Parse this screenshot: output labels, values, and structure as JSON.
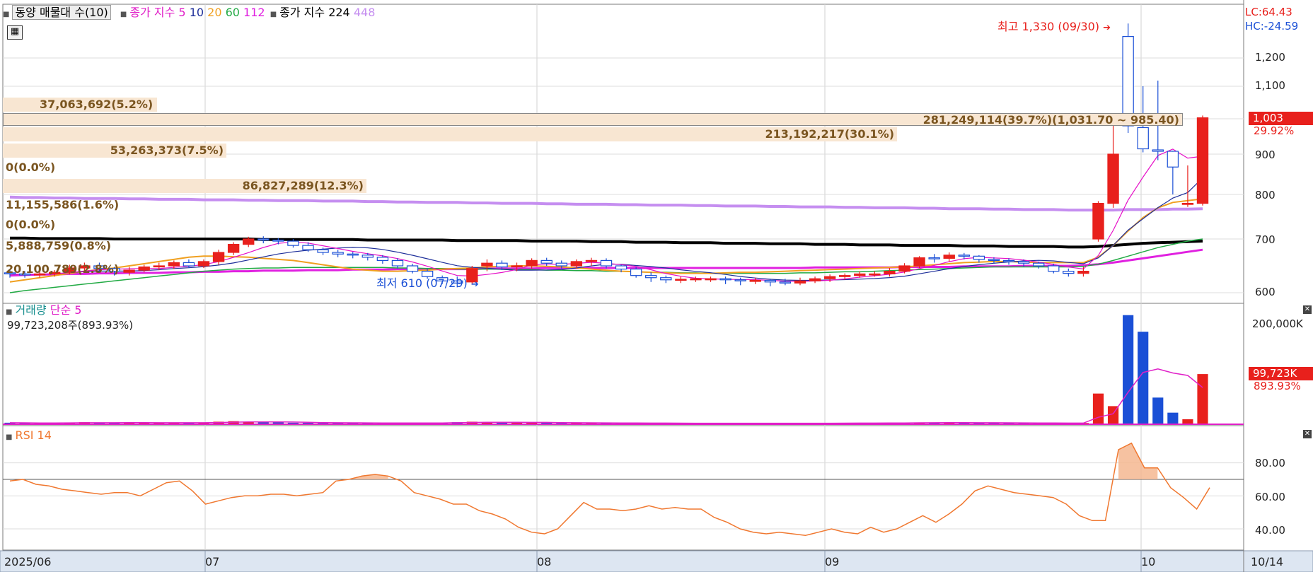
{
  "header": {
    "indicator_label": "동양 매물대 수(10)",
    "ma_label": "종가 지수",
    "ma_periods": [
      "5",
      "10",
      "20",
      "60",
      "112"
    ],
    "ma2_label": "종가 지수 224",
    "ma2_extra": "448"
  },
  "colors": {
    "up": "#e8201c",
    "down": "#1a4fd6",
    "ma5": "#e60fc8",
    "ma10": "#1e2f9a",
    "ma20": "#f0a020",
    "ma60": "#22aa44",
    "ma112": "#e020e0",
    "ma224": "#000000",
    "ma448": "#c58ef0",
    "rsi": "#f07830",
    "volume_ma": "#e020c8"
  },
  "price_panel": {
    "lc": "LC:64.43",
    "hc": "HC:-24.59",
    "last_price_tag": "1,003",
    "last_change_tag": "29.92%",
    "high_marker": "최고 1,330 (09/30)",
    "low_marker": "최저 610 (07/29)",
    "y_ticks": [
      "1,200",
      "1,100",
      "1,000",
      "900",
      "800",
      "700",
      "600"
    ],
    "volume_profile": [
      "37,063,692(5.2%)",
      "281,249,114(39.7%)(1,031.70 ~ 985.40)",
      "213,192,217(30.1%)",
      "53,263,373(7.5%)",
      "0(0.0%)",
      "86,827,289(12.3%)",
      "11,155,586(1.6%)",
      "0(0.0%)",
      "5,888,759(0.8%)",
      "20,100,789(2.8%)"
    ]
  },
  "volume_panel": {
    "title": "거래량",
    "ma_label": "단순 5",
    "current": "99,723,208주(893.93%)",
    "y_tick": "200,000K",
    "last_tag": "99,723K",
    "last_pct": "893.93%"
  },
  "rsi_panel": {
    "title": "RSI 14",
    "y_ticks": [
      "80.00",
      "60.00",
      "40.00"
    ]
  },
  "x_axis": {
    "labels": [
      "2025/06",
      "07",
      "08",
      "09",
      "10"
    ],
    "right_label": "10/14"
  },
  "chart_data": [
    {
      "type": "candlestick",
      "ylim": [
        580,
        1360
      ],
      "x": [
        "06/16",
        "06/17",
        "06/18",
        "06/19",
        "06/20",
        "06/23",
        "06/24",
        "06/25",
        "06/26",
        "06/27",
        "06/30",
        "07/01",
        "07/02",
        "07/03",
        "07/04",
        "07/07",
        "07/08",
        "07/09",
        "07/10",
        "07/11",
        "07/14",
        "07/15",
        "07/16",
        "07/17",
        "07/18",
        "07/21",
        "07/22",
        "07/23",
        "07/24",
        "07/25",
        "07/28",
        "07/29",
        "07/30",
        "07/31",
        "08/01",
        "08/04",
        "08/05",
        "08/06",
        "08/07",
        "08/08",
        "08/11",
        "08/12",
        "08/13",
        "08/14",
        "08/18",
        "08/19",
        "08/20",
        "08/21",
        "08/22",
        "08/25",
        "08/26",
        "08/27",
        "08/28",
        "08/29",
        "09/01",
        "09/02",
        "09/03",
        "09/04",
        "09/05",
        "09/08",
        "09/09",
        "09/10",
        "09/11",
        "09/12",
        "09/15",
        "09/16",
        "09/17",
        "09/18",
        "09/19",
        "09/22",
        "09/23",
        "09/24",
        "09/25",
        "09/26",
        "09/29",
        "09/30",
        "10/01",
        "10/02",
        "10/10",
        "10/13",
        "10/14"
      ],
      "open": [
        637,
        635,
        633,
        635,
        638,
        646,
        650,
        645,
        638,
        642,
        648,
        650,
        656,
        650,
        658,
        675,
        690,
        700,
        698,
        696,
        688,
        680,
        675,
        672,
        670,
        666,
        660,
        650,
        640,
        628,
        622,
        620,
        650,
        655,
        648,
        650,
        660,
        655,
        650,
        658,
        660,
        650,
        644,
        632,
        628,
        624,
        625,
        626,
        626,
        624,
        622,
        623,
        620,
        618,
        622,
        626,
        630,
        632,
        635,
        635,
        640,
        650,
        665,
        664,
        670,
        668,
        662,
        660,
        658,
        655,
        650,
        640,
        636,
        700,
        780,
        1280,
        975,
        912,
        908,
        778,
        780
      ],
      "close": [
        635,
        633,
        635,
        638,
        646,
        650,
        645,
        640,
        642,
        648,
        650,
        656,
        650,
        658,
        675,
        690,
        700,
        698,
        696,
        688,
        680,
        675,
        672,
        670,
        666,
        660,
        650,
        640,
        630,
        622,
        618,
        645,
        655,
        648,
        650,
        660,
        655,
        650,
        658,
        660,
        650,
        644,
        632,
        628,
        624,
        625,
        626,
        626,
        624,
        622,
        623,
        620,
        618,
        622,
        626,
        630,
        632,
        635,
        635,
        640,
        650,
        665,
        664,
        670,
        668,
        662,
        660,
        658,
        655,
        650,
        640,
        636,
        640,
        780,
        900,
        980,
        915,
        908,
        868,
        780,
        1003
      ],
      "high": [
        642,
        640,
        640,
        642,
        652,
        656,
        656,
        648,
        648,
        652,
        656,
        660,
        662,
        662,
        680,
        694,
        705,
        706,
        702,
        700,
        694,
        684,
        680,
        676,
        674,
        670,
        664,
        654,
        645,
        632,
        630,
        650,
        662,
        660,
        656,
        664,
        665,
        660,
        662,
        665,
        664,
        652,
        648,
        638,
        632,
        630,
        630,
        630,
        630,
        628,
        628,
        626,
        626,
        628,
        630,
        634,
        636,
        640,
        640,
        646,
        655,
        668,
        672,
        675,
        674,
        670,
        666,
        664,
        662,
        658,
        654,
        645,
        648,
        785,
        1010,
        1330,
        1100,
        1120,
        910,
        872,
        1010
      ],
      "low": [
        628,
        628,
        628,
        630,
        634,
        640,
        640,
        632,
        632,
        638,
        642,
        644,
        646,
        646,
        652,
        670,
        685,
        692,
        690,
        684,
        676,
        670,
        666,
        664,
        660,
        654,
        645,
        636,
        626,
        616,
        610,
        615,
        640,
        642,
        640,
        645,
        650,
        645,
        645,
        650,
        645,
        638,
        628,
        620,
        618,
        618,
        620,
        620,
        616,
        614,
        616,
        612,
        614,
        614,
        618,
        620,
        624,
        628,
        630,
        630,
        636,
        646,
        656,
        658,
        662,
        656,
        654,
        652,
        648,
        645,
        636,
        630,
        630,
        695,
        770,
        960,
        905,
        885,
        800,
        772,
        775
      ],
      "ma20": [
        620,
        624,
        628,
        632,
        636,
        640,
        643,
        646,
        650,
        654,
        658,
        662,
        666,
        668,
        668,
        667,
        666,
        664,
        662,
        660,
        656,
        652,
        648,
        644,
        642,
        640,
        640,
        641,
        642,
        644,
        645,
        646,
        648,
        649,
        650,
        650,
        649,
        648,
        646,
        644,
        642,
        640,
        639,
        638,
        637,
        636,
        636,
        636,
        637,
        638,
        638,
        639,
        640,
        641,
        642,
        643,
        644,
        645,
        646,
        647,
        648,
        650,
        652,
        654,
        656,
        657,
        658,
        658,
        657,
        656,
        656,
        656,
        656,
        666,
        688,
        718,
        748,
        770,
        782,
        786,
        790
      ],
      "ma60": [
        600,
        604,
        607,
        610,
        613,
        616,
        619,
        622,
        625,
        628,
        631,
        634,
        637,
        640,
        642,
        644,
        645,
        646,
        646,
        647,
        647,
        647,
        647,
        647,
        647,
        647,
        646,
        646,
        645,
        645,
        644,
        644,
        644,
        644,
        643,
        643,
        642,
        642,
        641,
        641,
        640,
        640,
        639,
        638,
        638,
        637,
        637,
        636,
        636,
        636,
        636,
        636,
        636,
        637,
        637,
        638,
        639,
        639,
        640,
        641,
        642,
        643,
        644,
        645,
        646,
        647,
        648,
        648,
        648,
        648,
        648,
        648,
        649,
        653,
        660,
        668,
        676,
        684,
        690,
        696,
        700
      ],
      "ma112": [
        632,
        633,
        634,
        634,
        635,
        635,
        636,
        636,
        637,
        637,
        637,
        638,
        638,
        639,
        639,
        640,
        640,
        641,
        641,
        641,
        642,
        642,
        642,
        643,
        643,
        643,
        644,
        644,
        644,
        644,
        644,
        644,
        645,
        645,
        645,
        645,
        646,
        646,
        646,
        646,
        646,
        646,
        646,
        646,
        646,
        646,
        646,
        646,
        646,
        646,
        646,
        646,
        646,
        646,
        647,
        647,
        647,
        647,
        647,
        647,
        648,
        648,
        648,
        648,
        649,
        649,
        649,
        649,
        650,
        650,
        650,
        650,
        651,
        653,
        656,
        660,
        664,
        668,
        672,
        676,
        680
      ],
      "ma224": [
        702,
        702,
        701,
        701,
        701,
        701,
        701,
        700,
        700,
        700,
        700,
        700,
        700,
        700,
        700,
        700,
        700,
        699,
        699,
        699,
        699,
        699,
        699,
        699,
        698,
        698,
        698,
        698,
        698,
        698,
        697,
        697,
        697,
        697,
        697,
        696,
        696,
        696,
        696,
        695,
        695,
        695,
        694,
        694,
        694,
        693,
        693,
        693,
        692,
        692,
        692,
        691,
        691,
        691,
        690,
        690,
        690,
        689,
        689,
        689,
        688,
        688,
        688,
        688,
        687,
        687,
        687,
        686,
        686,
        686,
        686,
        685,
        685,
        686,
        688,
        690,
        692,
        693,
        694,
        695,
        696
      ],
      "ma448": [
        794,
        793,
        793,
        792,
        792,
        791,
        791,
        791,
        790,
        790,
        789,
        789,
        789,
        788,
        788,
        788,
        787,
        787,
        786,
        786,
        786,
        785,
        785,
        785,
        784,
        784,
        783,
        783,
        782,
        782,
        782,
        781,
        781,
        780,
        780,
        780,
        779,
        779,
        778,
        778,
        778,
        777,
        777,
        776,
        776,
        776,
        775,
        775,
        774,
        774,
        774,
        773,
        773,
        772,
        772,
        772,
        771,
        771,
        770,
        770,
        770,
        769,
        769,
        768,
        768,
        768,
        767,
        767,
        766,
        766,
        766,
        765,
        765,
        765,
        765,
        766,
        766,
        766,
        767,
        767,
        768
      ]
    },
    {
      "type": "bar",
      "ylabel": "거래량",
      "values": [
        3000,
        2500,
        2000,
        2200,
        3500,
        4000,
        3000,
        2500,
        2500,
        3000,
        3000,
        3500,
        3000,
        3500,
        5000,
        6000,
        5000,
        4000,
        3500,
        3000,
        3000,
        2500,
        2500,
        2500,
        2500,
        2000,
        2500,
        2500,
        3000,
        3500,
        4000,
        5000,
        4000,
        3000,
        3000,
        3500,
        3000,
        2500,
        2500,
        2500,
        2500,
        2000,
        2000,
        2000,
        2000,
        2000,
        2000,
        2000,
        2000,
        2000,
        2000,
        2000,
        2000,
        2000,
        2000,
        2000,
        2500,
        2500,
        2500,
        2500,
        3000,
        3500,
        3000,
        3000,
        3000,
        2500,
        2500,
        2500,
        2500,
        2500,
        2000,
        2000,
        2500,
        61000,
        36000,
        217000,
        184000,
        53000,
        23000,
        10000,
        99723
      ],
      "ma": [
        3000,
        2800,
        2600,
        2500,
        2700,
        3000,
        3000,
        3000,
        3100,
        3200,
        3000,
        3000,
        3000,
        3000,
        3400,
        4100,
        4500,
        4700,
        4700,
        4300,
        3800,
        3200,
        2900,
        2800,
        2700,
        2500,
        2500,
        2500,
        2500,
        2600,
        2900,
        3500,
        3800,
        3900,
        3800,
        3700,
        3600,
        3200,
        2900,
        2800,
        2700,
        2500,
        2400,
        2300,
        2200,
        2100,
        2000,
        2000,
        2000,
        2000,
        2000,
        2000,
        2000,
        2000,
        2000,
        2000,
        2100,
        2200,
        2300,
        2400,
        2500,
        2800,
        2900,
        3100,
        3100,
        3000,
        2900,
        2800,
        2700,
        2500,
        2400,
        2300,
        2300,
        13800,
        20800,
        63500,
        103000,
        110000,
        102000,
        97000,
        73000
      ]
    },
    {
      "type": "line",
      "ylabel": "RSI 14",
      "ylim": [
        28,
        100
      ],
      "reference_line": 70,
      "values": [
        69,
        70,
        67,
        66,
        64,
        63,
        62,
        61,
        62,
        62,
        60,
        64,
        68,
        69,
        63,
        55,
        57,
        59,
        60,
        60,
        61,
        61,
        60,
        61,
        62,
        69,
        70,
        72,
        73,
        72,
        69,
        62,
        60,
        58,
        55,
        55,
        51,
        49,
        46,
        41,
        38,
        37,
        40,
        48,
        56,
        52,
        52,
        51,
        52,
        54,
        52,
        53,
        52,
        52,
        47,
        44,
        40,
        38,
        37,
        38,
        37,
        36,
        38,
        40,
        38,
        37,
        41,
        38,
        40,
        44,
        48,
        44,
        49,
        55,
        63,
        66,
        64,
        62,
        61,
        60,
        59,
        55,
        48,
        45,
        45,
        88,
        92,
        77,
        77,
        65,
        59,
        52,
        65
      ]
    }
  ]
}
